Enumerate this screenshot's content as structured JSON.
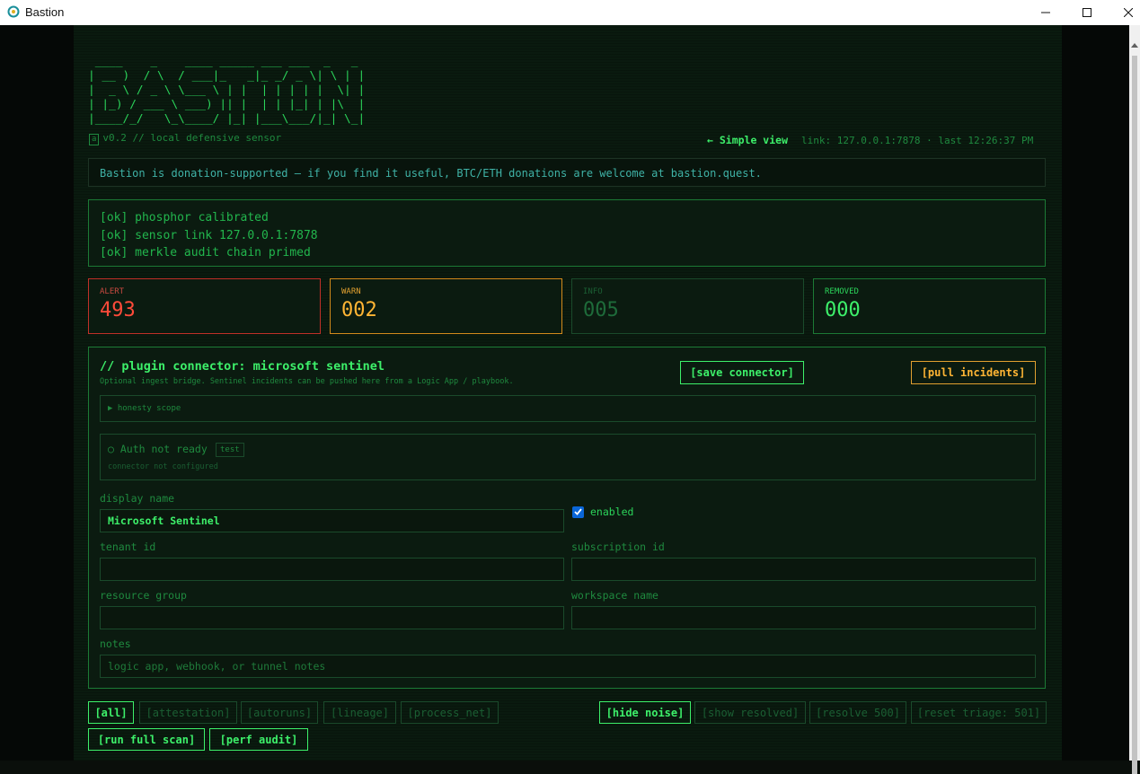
{
  "window": {
    "title": "Bastion",
    "controls": [
      "minimize-icon",
      "maximize-icon",
      "close-icon"
    ]
  },
  "header": {
    "ascii_logo": " ____    _    ____ _____ ___ ___  _   _ \n| __ )  / \\  / ___|_   _|_ _/ _ \\| \\ | |\n|  _ \\ / _ \\ \\___ \\ | |  | | | | |  \\| |\n| |_) / ___ \\ ___) || |  | | |_| | |\\  |\n|____/_/   \\_\\____/ |_| |___\\___/|_| \\_|",
    "badge": "a",
    "version": "v0.2 // local defensive sensor",
    "simple_view": "← Simple view",
    "link_status": "link: 127.0.0.1:7878 · last 12:26:37 PM"
  },
  "donation_banner": "Bastion is donation-supported — if you find it useful, BTC/ETH donations are welcome at bastion.quest.",
  "boot_log": [
    "[ok] phosphor calibrated",
    "[ok] sensor link 127.0.0.1:7878",
    "[ok] merkle audit chain primed"
  ],
  "stats": {
    "alert": {
      "label": "ALERT",
      "value": "493"
    },
    "warn": {
      "label": "WARN",
      "value": "002"
    },
    "info": {
      "label": "INFO",
      "value": "005"
    },
    "removed": {
      "label": "REMOVED",
      "value": "000"
    }
  },
  "plugin": {
    "title": "// plugin connector: microsoft sentinel",
    "subtitle": "Optional ingest bridge. Sentinel incidents can be pushed here from a Logic App / playbook.",
    "save_label": "[save connector]",
    "pull_label": "[pull incidents]",
    "scope_label": "▶ honesty scope",
    "auth_status": "○ Auth not ready",
    "test_label": "test",
    "auth_detail": "connector not configured",
    "display_name_label": "display name",
    "display_name_value": "Microsoft Sentinel",
    "enabled_label": "enabled",
    "tenant_label": "tenant id",
    "subscription_label": "subscription id",
    "resource_group_label": "resource group",
    "workspace_label": "workspace name",
    "notes_label": "notes",
    "notes_placeholder": "logic app, webhook, or tunnel notes"
  },
  "filters": {
    "all": "[all]",
    "attestation": "[attestation]",
    "autoruns": "[autoruns]",
    "lineage": "[lineage]",
    "process_net": "[process_net]",
    "hide_noise": "[hide noise]",
    "show_resolved": "[show resolved]",
    "resolve": "[resolve 500]",
    "reset_triage": "[reset triage: 501]"
  },
  "actions": {
    "full_scan": "[run full scan]",
    "perf_audit": "[perf audit]"
  },
  "colors": {
    "phosphor": "#3df06a",
    "alert": "#ff4b3a",
    "warn": "#ffb534",
    "donation_text": "#3fb2a6"
  }
}
